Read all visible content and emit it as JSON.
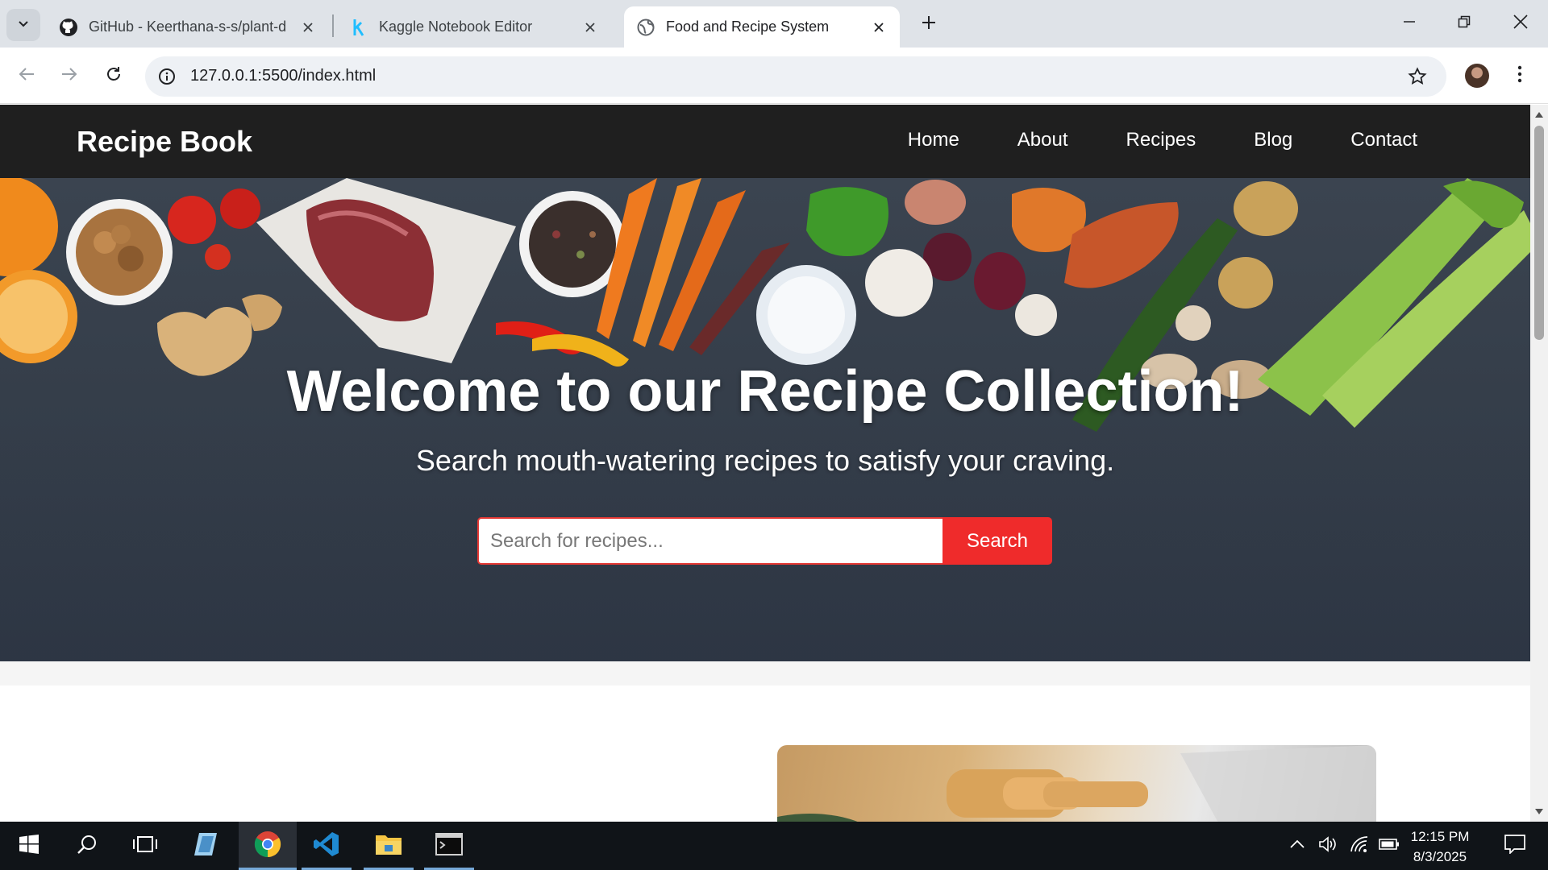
{
  "browser": {
    "tabs": [
      {
        "title": "GitHub - Keerthana-s-s/plant-d",
        "icon": "github-icon",
        "active": false
      },
      {
        "title": "Kaggle Notebook Editor",
        "icon": "kaggle-icon",
        "active": false
      },
      {
        "title": "Food and Recipe System",
        "icon": "globe-icon",
        "active": true
      }
    ],
    "url": "127.0.0.1:5500/index.html"
  },
  "site": {
    "logo": "Recipe Book",
    "nav": [
      "Home",
      "About",
      "Recipes",
      "Blog",
      "Contact"
    ]
  },
  "hero": {
    "title": "Welcome to our Recipe Collection!",
    "subtitle": "Search mouth-watering recipes to satisfy your craving.",
    "search_placeholder": "Search for recipes...",
    "search_button": "Search"
  },
  "taskbar": {
    "apps": [
      "start-icon",
      "search-icon",
      "task-view-icon",
      "app-icon",
      "chrome-icon",
      "vscode-icon",
      "file-explorer-icon",
      "terminal-icon"
    ],
    "time": "12:15 PM",
    "date": "8/3/2025"
  }
}
